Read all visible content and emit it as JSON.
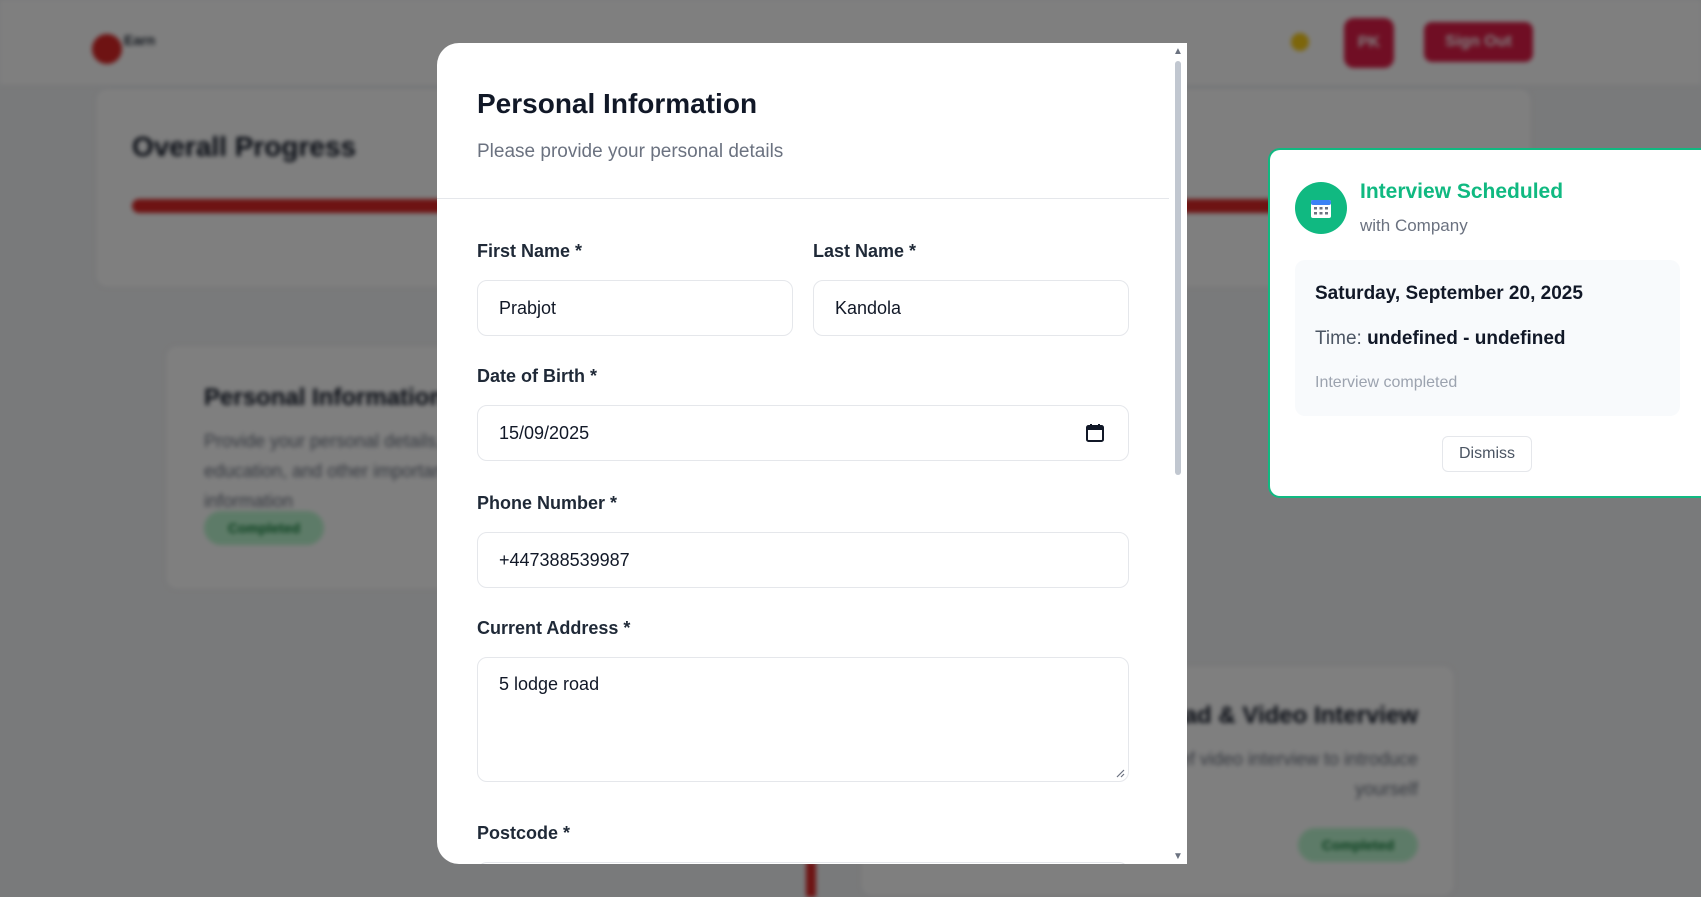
{
  "background": {
    "logo_text": "Earn",
    "avatar_initials": "PK",
    "sign_out_label": "Sign Out",
    "progress": {
      "title": "Overall Progress",
      "percent": 100
    },
    "steps": [
      {
        "title": "Personal Information",
        "description": "Provide your personal details, education, and other important information",
        "status": "Completed"
      },
      {
        "title": "Upload & Video Interview",
        "description": "Upload a brief video interview to introduce yourself",
        "status": "Completed"
      }
    ]
  },
  "modal": {
    "title": "Personal Information",
    "subtitle": "Please provide your personal details",
    "fields": {
      "first_name": {
        "label": "First Name *",
        "value": "Prabjot"
      },
      "last_name": {
        "label": "Last Name *",
        "value": "Kandola"
      },
      "dob": {
        "label": "Date of Birth *",
        "value": "15/09/2025"
      },
      "phone": {
        "label": "Phone Number *",
        "value": "+447388539987"
      },
      "address": {
        "label": "Current Address *",
        "value": "5 lodge road"
      },
      "postcode": {
        "label": "Postcode *"
      }
    }
  },
  "notification": {
    "title": "Interview Scheduled",
    "company": "with Company",
    "date": "Saturday, September 20, 2025",
    "time_label": "Time:",
    "time_value": "undefined - undefined",
    "status": "Interview completed",
    "dismiss_label": "Dismiss",
    "accent_color": "#10b981",
    "icon": "calendar-icon"
  }
}
